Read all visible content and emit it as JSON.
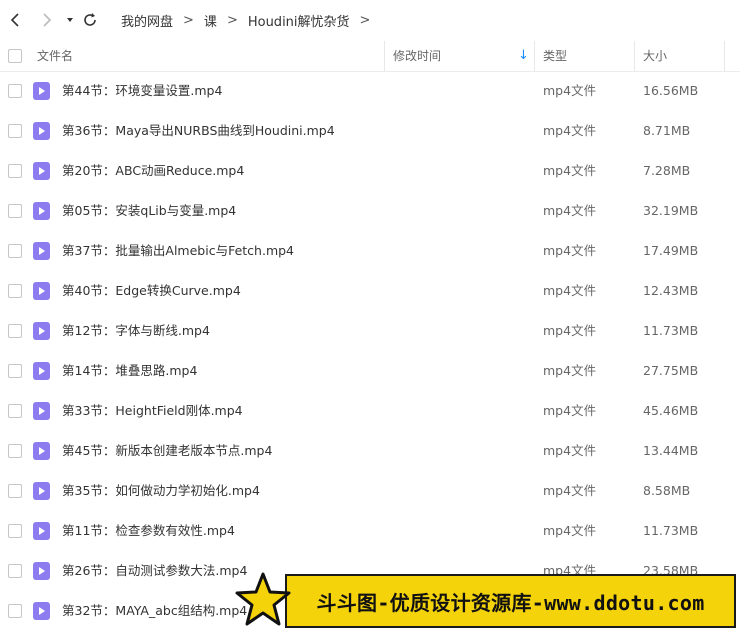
{
  "toolbar": {
    "icons": [
      "back-icon",
      "forward-icon",
      "history-dropdown-icon",
      "refresh-icon"
    ],
    "breadcrumbs": [
      "我的网盘",
      "课",
      "Houdini解忧杂货"
    ]
  },
  "table": {
    "columns": {
      "name": "文件名",
      "modified": "修改时间",
      "type": "类型",
      "size": "大小"
    },
    "sort_indicator": "↓",
    "rows": [
      {
        "name": "第44节：环境变量设置.mp4",
        "type": "mp4文件",
        "size": "16.56MB"
      },
      {
        "name": "第36节：Maya导出NURBS曲线到Houdini.mp4",
        "type": "mp4文件",
        "size": "8.71MB"
      },
      {
        "name": "第20节：ABC动画Reduce.mp4",
        "type": "mp4文件",
        "size": "7.28MB"
      },
      {
        "name": "第05节：安装qLib与变量.mp4",
        "type": "mp4文件",
        "size": "32.19MB"
      },
      {
        "name": "第37节：批量输出Almebic与Fetch.mp4",
        "type": "mp4文件",
        "size": "17.49MB"
      },
      {
        "name": "第40节：Edge转换Curve.mp4",
        "type": "mp4文件",
        "size": "12.43MB"
      },
      {
        "name": "第12节：字体与断线.mp4",
        "type": "mp4文件",
        "size": "11.73MB"
      },
      {
        "name": "第14节：堆叠思路.mp4",
        "type": "mp4文件",
        "size": "27.75MB"
      },
      {
        "name": "第33节：HeightField刚体.mp4",
        "type": "mp4文件",
        "size": "45.46MB"
      },
      {
        "name": "第45节：新版本创建老版本节点.mp4",
        "type": "mp4文件",
        "size": "13.44MB"
      },
      {
        "name": "第35节：如何做动力学初始化.mp4",
        "type": "mp4文件",
        "size": "8.58MB"
      },
      {
        "name": "第11节：检查参数有效性.mp4",
        "type": "mp4文件",
        "size": "11.73MB"
      },
      {
        "name": "第26节：自动测试参数大法.mp4",
        "type": "mp4文件",
        "size": "23.58MB"
      },
      {
        "name": "第32节：MAYA_abc组结构.mp4",
        "type": "",
        "size": ""
      }
    ]
  },
  "watermark": {
    "text": "斗斗图-优质设计资源库-www.ddotu.com"
  },
  "colors": {
    "file_icon": "#8d7cf0",
    "sort_arrow": "#1a8cff",
    "banner": "#f5d30b"
  }
}
